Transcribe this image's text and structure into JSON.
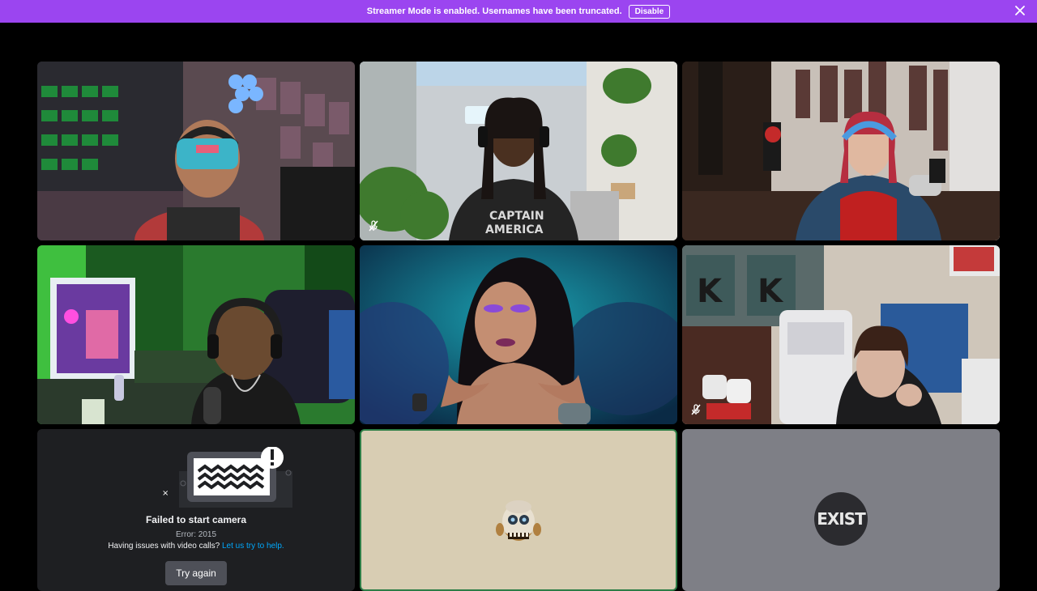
{
  "banner": {
    "message": "Streamer Mode is enabled. Usernames have been truncated.",
    "disable_label": "Disable",
    "close_icon": "close-icon",
    "color": "#9b45f0"
  },
  "tiles": [
    {
      "kind": "video",
      "muted": false
    },
    {
      "kind": "video",
      "muted": true
    },
    {
      "kind": "video",
      "muted": false
    },
    {
      "kind": "video",
      "muted": false
    },
    {
      "kind": "video",
      "muted": false
    },
    {
      "kind": "video",
      "muted": true
    },
    {
      "kind": "camera-error"
    },
    {
      "kind": "avatar",
      "speaking": true
    },
    {
      "kind": "avatar",
      "speaking": false
    }
  ],
  "camera_error": {
    "title": "Failed to start camera",
    "error": "Error: 2015",
    "help_prefix": "Having issues with video calls?",
    "help_link": "Let us try to help.",
    "try_again_label": "Try again"
  },
  "avatar_exist": {
    "text": "EXIST"
  },
  "colors": {
    "background": "#000000",
    "speaking_border": "#2d7d46",
    "link": "#00a8fc"
  }
}
